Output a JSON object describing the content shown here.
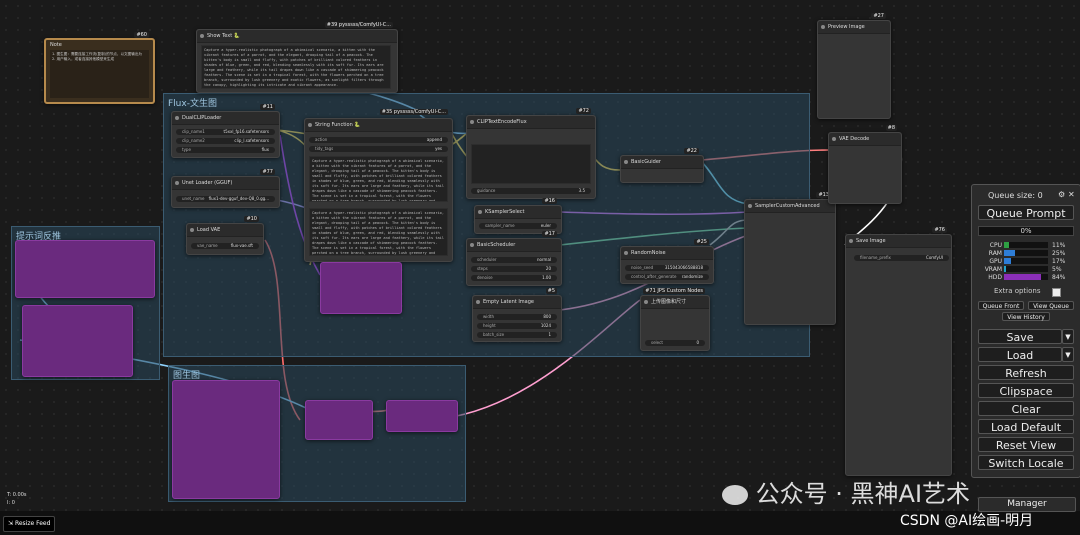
{
  "groups": {
    "flux": "Flux-文生图",
    "reverse": "提示词反推",
    "upscale": "图生图"
  },
  "note": {
    "id": "#60",
    "title": "Note",
    "lines": [
      "1. 图生图：需要连接工作流(复制)的节点，以文图输出为",
      "2. 用户输入，或者连接其他模型来生成"
    ]
  },
  "show_text": {
    "id": "#39 pysssss/ComfyUI-C...",
    "title": "Show Text 🐍",
    "text": "Capture a hyper-realistic photograph of a whimsical scenario, a kitten with the vibrant features of a parrot, and the elegant, drooping tail of a peacock. The kitten's body is small and fluffy, with patches of brilliant colored feathers in shades of blue, green, and red, blending seamlessly with its soft fur. Its ears are large and feathery, while its tail drapes down like a cascade of shimmering peacock feathers. The scene is set in a tropical forest, with the flowers perched on a tree branch, surrounded by lush greenery and exotic flowers, as sunlight filters through the canopy, highlighting its intricate and vibrant appearance."
  },
  "nodes": {
    "dual_clip": {
      "id": "#11",
      "title": "DualCLIPLoader",
      "w": [
        [
          "clip_name1",
          "t5xxl_fp16.safetensors"
        ],
        [
          "clip_name2",
          "clip_l.safetensors"
        ],
        [
          "type",
          "flux"
        ]
      ]
    },
    "unet_gguf": {
      "id": "#77",
      "title": "Unet Loader (GGUF)",
      "w": [
        [
          "unet_name",
          "flux1-dev-gguf_dev-Q8_0.gg..."
        ]
      ]
    },
    "load_vae": {
      "id": "#10",
      "title": "Load VAE",
      "w": [
        [
          "vae_name",
          "flux-vae.sft"
        ]
      ]
    },
    "string_fn": {
      "id": "#35 pysssss/ComfyUI-C...",
      "title": "String Function 🐍",
      "w": [
        [
          "action",
          "append"
        ],
        [
          "tidy_tags",
          "yes"
        ]
      ]
    },
    "clip_text": {
      "id": "#72",
      "title": "CLIPTextEncodeFlux",
      "w": [
        [
          "guidance",
          "3.5"
        ]
      ]
    },
    "basic_guider": {
      "id": "#22",
      "title": "BasicGuider"
    },
    "ksampler_select": {
      "id": "#16",
      "title": "KSamplerSelect",
      "w": [
        [
          "sampler_name",
          "euler"
        ]
      ]
    },
    "basic_scheduler": {
      "id": "#17",
      "title": "BasicScheduler",
      "w": [
        [
          "scheduler",
          "normal"
        ],
        [
          "steps",
          "20"
        ],
        [
          "denoise",
          "1.00"
        ]
      ]
    },
    "random_noise": {
      "id": "#25",
      "title": "RandomNoise",
      "w": [
        [
          "noise_seed",
          "315043066588818"
        ],
        [
          "control_after_generate",
          "randomize"
        ]
      ]
    },
    "empty_latent": {
      "id": "#5",
      "title": "Empty Latent Image",
      "w": [
        [
          "width",
          "800"
        ],
        [
          "height",
          "1024"
        ],
        [
          "batch_size",
          "1"
        ]
      ]
    },
    "upscale_custom": {
      "id": "#71 JPS Custom Nodes",
      "title": "上传图像和尺寸",
      "w": [
        [
          "select",
          "0"
        ]
      ]
    },
    "sampler_custom": {
      "id": "#13",
      "title": "SamplerCustomAdvanced"
    },
    "preview_image": {
      "id": "#27",
      "title": "Preview Image"
    },
    "vae_decode": {
      "id": "#8",
      "title": "VAE Decode"
    },
    "save_image": {
      "id": "#76",
      "title": "Save Image",
      "w": [
        [
          "filename_prefix",
          "ComfyUI"
        ]
      ]
    }
  },
  "status": {
    "time": "T: 0.00s",
    "line2": "I: 0"
  },
  "resize_feed": "Resize Feed",
  "menu": {
    "queue_size": "Queue size: 0",
    "queue_prompt": "Queue Prompt",
    "progress": "0%",
    "stats": [
      {
        "label": "CPU",
        "value": 11,
        "text": "11%",
        "color": "#2ea043"
      },
      {
        "label": "RAM",
        "value": 25,
        "text": "25%",
        "color": "#2e7dd6"
      },
      {
        "label": "GPU",
        "value": 17,
        "text": "17%",
        "color": "#2e7dd6"
      },
      {
        "label": "VRAM",
        "value": 5,
        "text": "5%",
        "color": "#22a5c9"
      },
      {
        "label": "HDD",
        "value": 84,
        "text": "84%",
        "color": "#8b2fb8"
      }
    ],
    "extra_options": "Extra options",
    "queue_front": "Queue Front",
    "view_queue": "View Queue",
    "view_history": "View History",
    "save": "Save",
    "load": "Load",
    "refresh": "Refresh",
    "clipspace": "Clipspace",
    "clear": "Clear",
    "load_default": "Load Default",
    "reset_view": "Reset View",
    "switch_locale": "Switch Locale",
    "manager": "Manager"
  },
  "watermark": {
    "line1": "公众号 · 黑神AI艺术",
    "line2": "CSDN @AI绘画-明月"
  }
}
